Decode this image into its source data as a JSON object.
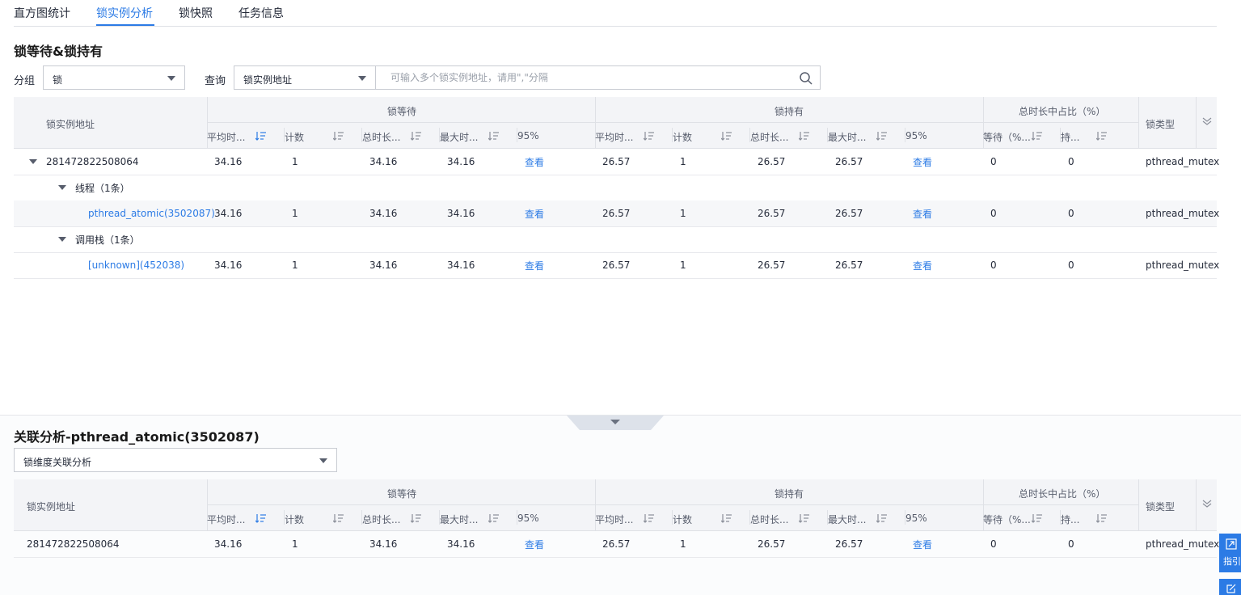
{
  "tabs": [
    "直方图统计",
    "锁实例分析",
    "锁快照",
    "任务信息"
  ],
  "active_tab": 1,
  "section1_title": "锁等待&锁持有",
  "filters": {
    "group_label": "分组",
    "group_value": "锁",
    "query_label": "查询",
    "query_type": "锁实例地址",
    "search_placeholder": "可输入多个锁实例地址，请用\",\"分隔"
  },
  "columns": {
    "addr": "锁实例地址",
    "wait_group": "锁等待",
    "hold_group": "锁持有",
    "ratio_group": "总时长中占比（%）",
    "locktype": "锁类型",
    "avg": "平均时...",
    "count": "计数",
    "total": "总时长...",
    "max": "最大时...",
    "p95": "95%",
    "ratio_wait": "等待（%...",
    "ratio_hold": "持..."
  },
  "rows": [
    {
      "name": "281472822508064",
      "wait": [
        "34.16",
        "1",
        "34.16",
        "34.16"
      ],
      "view": "查看",
      "hold": [
        "26.57",
        "1",
        "26.57",
        "26.57"
      ],
      "ratio": [
        "0",
        "0"
      ],
      "type": "pthread_mutex"
    },
    {
      "group": "线程（1条）"
    },
    {
      "name": "pthread_atomic(3502087)",
      "wait": [
        "34.16",
        "1",
        "34.16",
        "34.16"
      ],
      "view": "查看",
      "hold": [
        "26.57",
        "1",
        "26.57",
        "26.57"
      ],
      "ratio": [
        "0",
        "0"
      ],
      "type": "pthread_mutex"
    },
    {
      "group": "调用栈（1条）"
    },
    {
      "name": "[unknown](452038)",
      "wait": [
        "34.16",
        "1",
        "34.16",
        "34.16"
      ],
      "view": "查看",
      "hold": [
        "26.57",
        "1",
        "26.57",
        "26.57"
      ],
      "ratio": [
        "0",
        "0"
      ],
      "type": "pthread_mutex"
    }
  ],
  "section2_title": "关联分析-pthread_atomic(3502087)",
  "relation_select": "锁维度关联分析",
  "rows2": [
    {
      "name": "281472822508064",
      "wait": [
        "34.16",
        "1",
        "34.16",
        "34.16"
      ],
      "view": "查看",
      "hold": [
        "26.57",
        "1",
        "26.57",
        "26.57"
      ],
      "ratio": [
        "0",
        "0"
      ],
      "type": "pthread_mutex"
    }
  ],
  "side_buttons": [
    "指引"
  ],
  "colors": {
    "accent": "#2c7be5",
    "header_bg": "#f3f4f7",
    "text": "#252b3a"
  }
}
